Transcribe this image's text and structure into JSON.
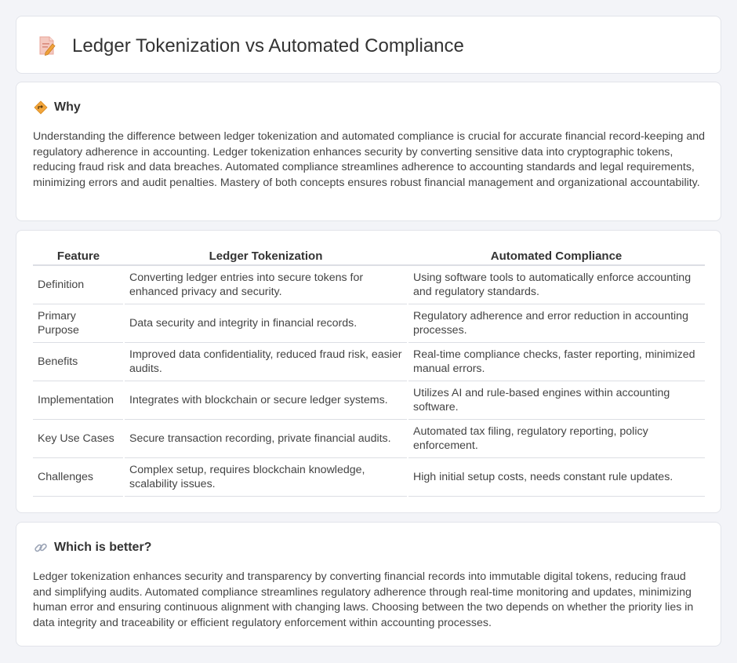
{
  "header": {
    "title": "Ledger Tokenization vs Automated Compliance"
  },
  "why": {
    "title": "Why",
    "text": "Understanding the difference between ledger tokenization and automated compliance is crucial for accurate financial record-keeping and regulatory adherence in accounting. Ledger tokenization enhances security by converting sensitive data into cryptographic tokens, reducing fraud risk and data breaches. Automated compliance streamlines adherence to accounting standards and legal requirements, minimizing errors and audit penalties. Mastery of both concepts ensures robust financial management and organizational accountability."
  },
  "table": {
    "headers": [
      "Feature",
      "Ledger Tokenization",
      "Automated Compliance"
    ],
    "rows": [
      [
        "Definition",
        "Converting ledger entries into secure tokens for enhanced privacy and security.",
        "Using software tools to automatically enforce accounting and regulatory standards."
      ],
      [
        "Primary Purpose",
        "Data security and integrity in financial records.",
        "Regulatory adherence and error reduction in accounting processes."
      ],
      [
        "Benefits",
        "Improved data confidentiality, reduced fraud risk, easier audits.",
        "Real-time compliance checks, faster reporting, minimized manual errors."
      ],
      [
        "Implementation",
        "Integrates with blockchain or secure ledger systems.",
        "Utilizes AI and rule-based engines within accounting software."
      ],
      [
        "Key Use Cases",
        "Secure transaction recording, private financial audits.",
        "Automated tax filing, regulatory reporting, policy enforcement."
      ],
      [
        "Challenges",
        "Complex setup, requires blockchain knowledge, scalability issues.",
        "High initial setup costs, needs constant rule updates."
      ]
    ]
  },
  "better": {
    "title": "Which is better?",
    "text": "Ledger tokenization enhances security and transparency by converting financial records into immutable digital tokens, reducing fraud and simplifying audits. Automated compliance streamlines regulatory adherence through real-time monitoring and updates, minimizing human error and ensuring continuous alignment with changing laws. Choosing between the two depends on whether the priority lies in data integrity and traceability or efficient regulatory enforcement within accounting processes."
  },
  "icons": {
    "header": "document-pencil-icon",
    "why": "diamond-signpost-icon",
    "better": "link-icon"
  }
}
